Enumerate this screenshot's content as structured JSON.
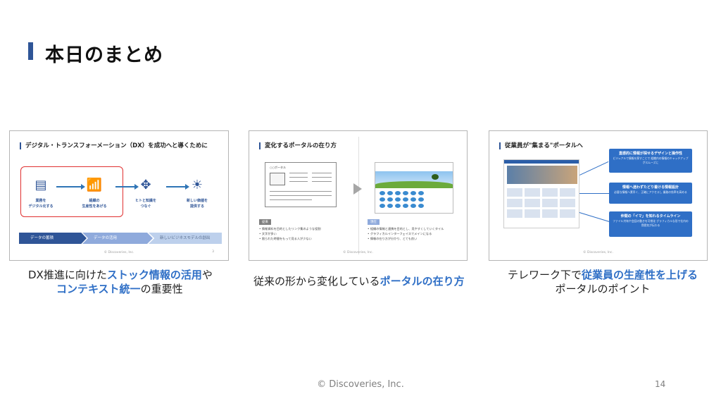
{
  "title": "本日のまとめ",
  "slides": [
    {
      "title": "デジタル・トランスフォーメーション（DX）を成功へと導くために",
      "steps": [
        {
          "icon": "document-icon",
          "label": "業務を\nデジタル化する"
        },
        {
          "icon": "growth-chart-icon",
          "label": "組織の\n生産性をあげる"
        },
        {
          "icon": "network-icon",
          "label": "ヒトと知識を\nつなぐ"
        },
        {
          "icon": "lightbulb-hand-icon",
          "label": "新しい価値を\n提供する"
        }
      ],
      "chevrons": [
        "データの蓄積",
        "データの活用",
        "新しいビジネスモデルの創出"
      ],
      "footer": "© Discoveries, Inc.",
      "page": "3"
    },
    {
      "title": "変化するポータルの在り方",
      "old_header": "○○ポータル",
      "old_tag": "従来",
      "old_bullets": [
        "情報資料を目的としたリンク集のような役割",
        "文字が多い",
        "限られた時間をもって見る人が少ない"
      ],
      "new_tag": "現在",
      "new_bullets": [
        "組織の情報と連携を目的とし、見やすくしていくタイル",
        "グラフィカルインターフェイスでメインになる",
        "情報の在り方が分かり、とても良い"
      ],
      "footer": "© Discoveries, Inc."
    },
    {
      "title": "従業員が\"集まる\"ポータルへ",
      "callouts": [
        {
          "title": "直感的に情報が探せるデザインと操作性",
          "sub": "ビジュアルで情報を探すことで\n組織内の情報のキャッチアップがスムーズに"
        },
        {
          "title": "情報へ迷わずたどり着ける情報設計",
          "sub": "必要な情報へ素早く、正確にアクセスし\n業務の効率を高める"
        },
        {
          "title": "仲間の「イマ」を知れるタイムライン",
          "sub": "ファイル共有や会話の動きを可視化\nグラフィカルな形で社内の雰囲気が伝わる"
        }
      ],
      "footer": "© Discoveries, Inc."
    }
  ],
  "captions": {
    "c1_pre": "DX推進に向けた",
    "c1_hl1": "ストック情報の活用",
    "c1_mid": "や",
    "c1_hl2": "コンテキスト統一",
    "c1_post": "の重要性",
    "c2_pre": "従来の形から変化している",
    "c2_hl": "ポータルの在り方",
    "c3_pre": "テレワーク下で",
    "c3_hl": "従業員の生産性を上げる",
    "c3_post": "ポータルのポイント"
  },
  "footer": "© Discoveries, Inc.",
  "page_number": "14",
  "colors": {
    "accent": "#2f6fc6",
    "title_bar": "#2f5597",
    "highlight_box": "#e03030"
  }
}
